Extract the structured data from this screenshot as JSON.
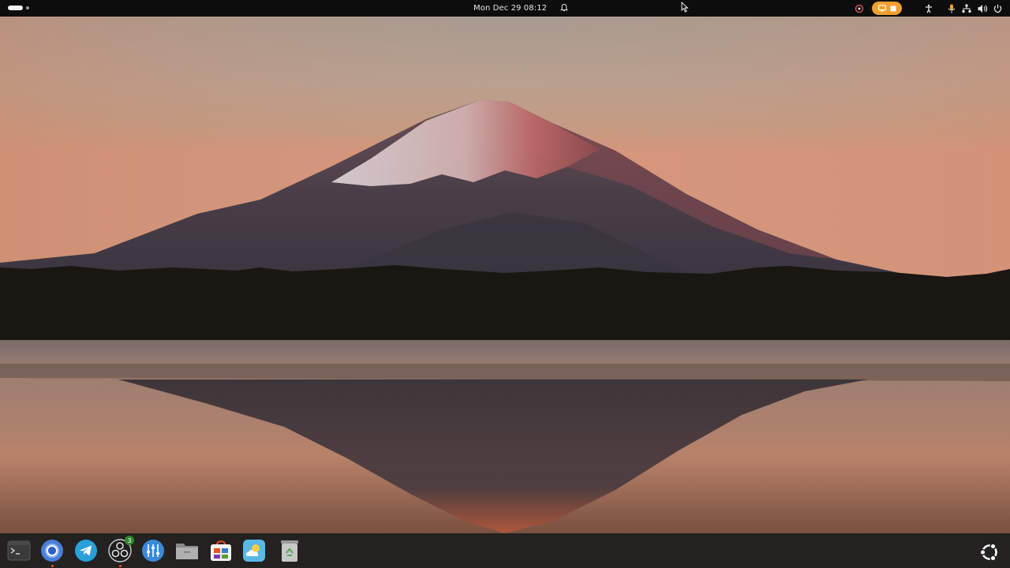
{
  "topbar": {
    "clock": "Mon Dec 29  08:12",
    "tray": [
      "screenshot-record-icon",
      "screen-share-indicator",
      "accessibility-icon",
      "microphone-icon",
      "network-icon",
      "volume-icon",
      "power-icon"
    ]
  },
  "dock": {
    "apps": [
      {
        "name": "terminal-icon",
        "running": false
      },
      {
        "name": "chromium-icon",
        "running": true
      },
      {
        "name": "telegram-icon",
        "running": false
      },
      {
        "name": "obs-studio-icon",
        "running": true,
        "badge": "3"
      },
      {
        "name": "equalizer-settings-icon",
        "running": false
      },
      {
        "name": "files-icon",
        "running": false
      },
      {
        "name": "software-store-icon",
        "running": false
      },
      {
        "name": "weather-icon",
        "running": false
      },
      {
        "name": "trash-icon",
        "running": false
      }
    ],
    "show_apps": "ubuntu-show-apps-icon"
  },
  "colors": {
    "topbar": "#0e0d0d",
    "dock": "#232221",
    "accent": "#e95420",
    "pill": "#f0a030"
  }
}
